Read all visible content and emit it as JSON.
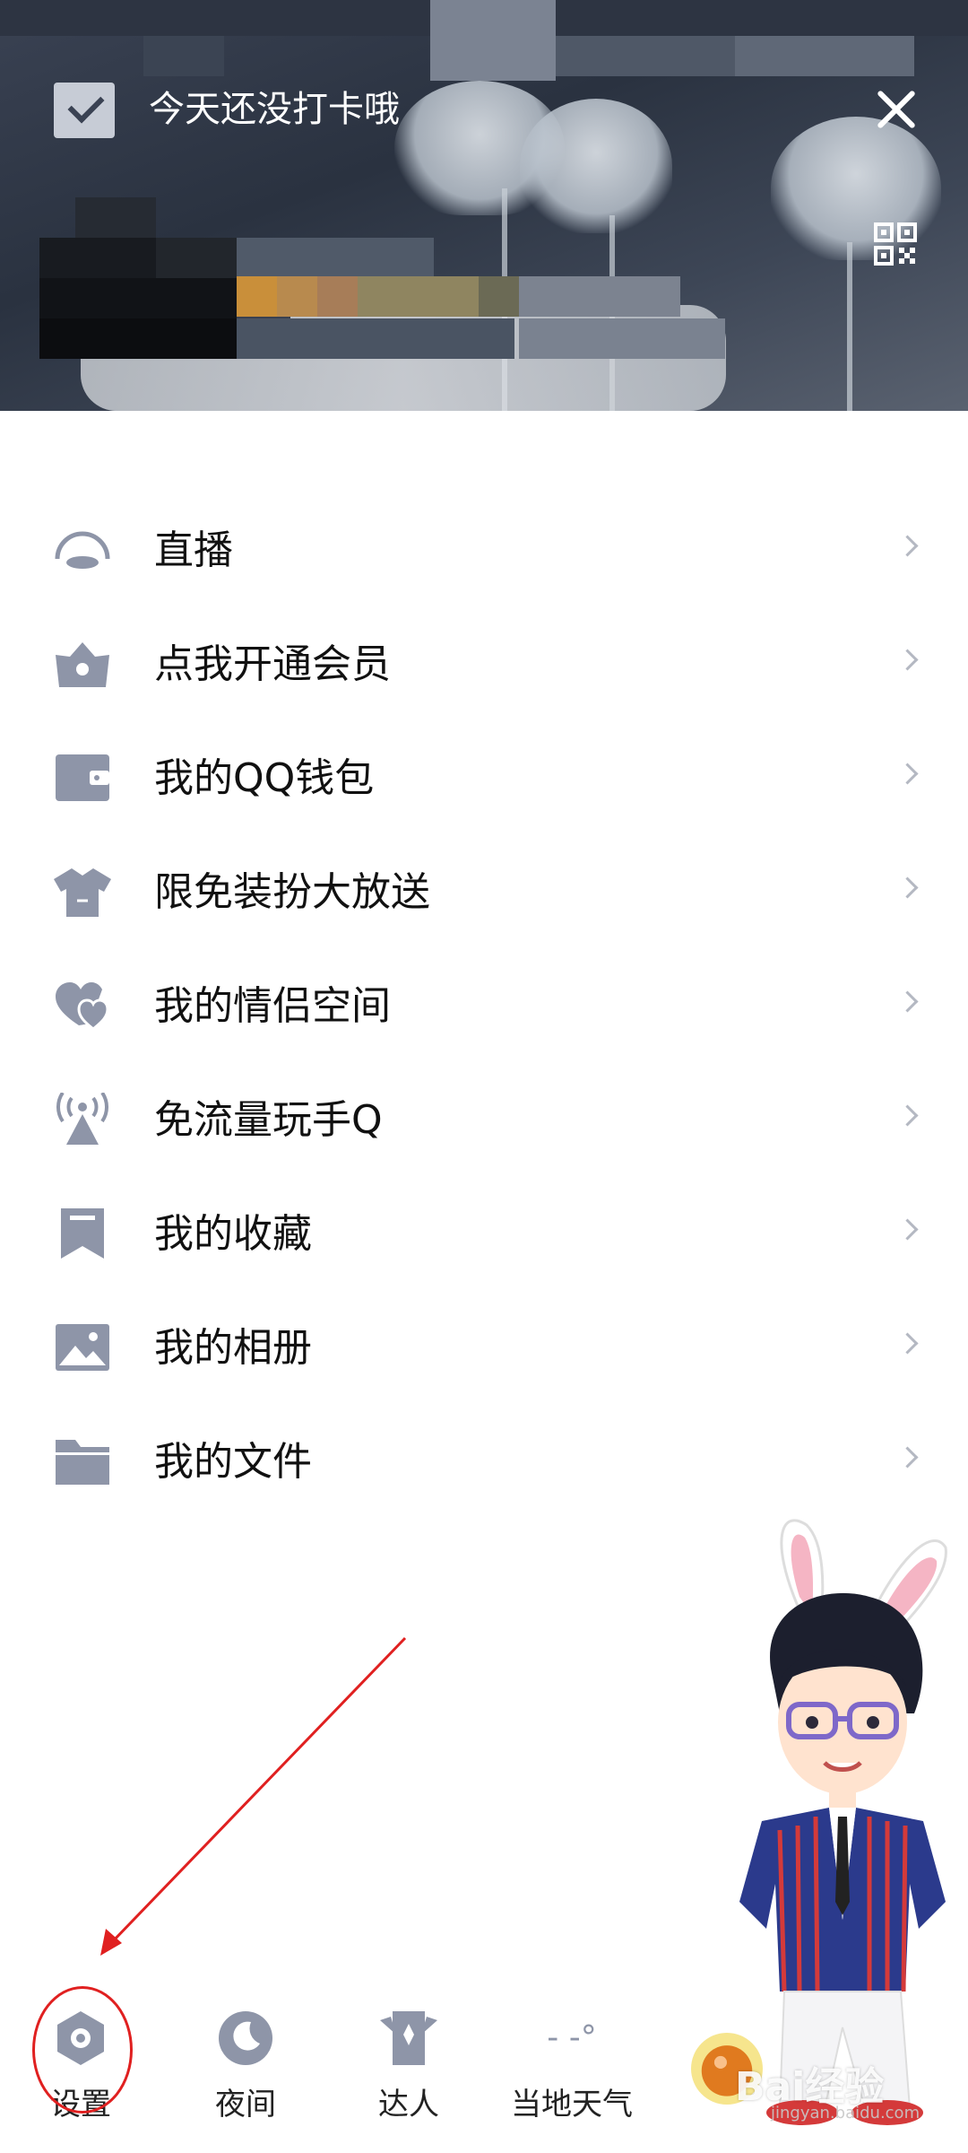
{
  "header": {
    "checkin_text": "今天还没打卡哦"
  },
  "menu": {
    "items": [
      {
        "label": "直播",
        "icon": "live-icon"
      },
      {
        "label": "点我开通会员",
        "icon": "vip-icon"
      },
      {
        "label": "我的QQ钱包",
        "icon": "wallet-icon"
      },
      {
        "label": "限免装扮大放送",
        "icon": "dress-up-icon"
      },
      {
        "label": "我的情侣空间",
        "icon": "couple-hearts-icon"
      },
      {
        "label": "免流量玩手Q",
        "icon": "signal-tower-icon"
      },
      {
        "label": "我的收藏",
        "icon": "bookmark-icon"
      },
      {
        "label": "我的相册",
        "icon": "photo-album-icon"
      },
      {
        "label": "我的文件",
        "icon": "folder-icon"
      }
    ]
  },
  "bottom_bar": {
    "settings": "设置",
    "night": "夜间",
    "expert": "达人",
    "weather": "当地天气",
    "weather_value": "- -°"
  },
  "watermark": {
    "brand": "Bai",
    "brand_rest": "经验",
    "url": "jingyan.baidu.com"
  },
  "colors": {
    "icon_gray": "#8e95a8",
    "annotation_red": "#e02020"
  }
}
